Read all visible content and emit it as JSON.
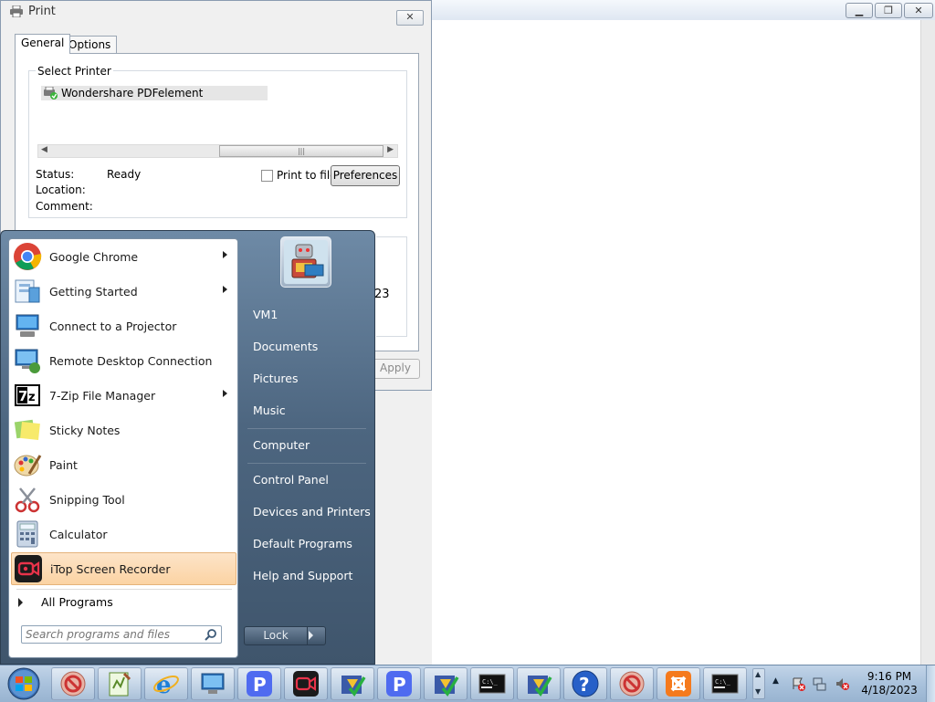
{
  "print_dialog": {
    "title": "Print",
    "close_label": "✕",
    "tabs": [
      "General",
      "Options"
    ],
    "select_printer_label": "Select Printer",
    "printer_name": "Wondershare PDFelement",
    "status_label": "Status:",
    "status_value": "Ready",
    "location_label": "Location:",
    "comment_label": "Comment:",
    "print_to_file_label": "Print to file",
    "preferences_label": "Preferences",
    "apply_label": "Apply",
    "page_numbers": "23"
  },
  "start_menu": {
    "programs": [
      {
        "label": "Google Chrome",
        "icon": "chrome-icon",
        "has_submenu": true
      },
      {
        "label": "Getting Started",
        "icon": "getting-started-icon",
        "has_submenu": true
      },
      {
        "label": "Connect to a Projector",
        "icon": "projector-icon",
        "has_submenu": false
      },
      {
        "label": "Remote Desktop Connection",
        "icon": "remote-desktop-icon",
        "has_submenu": false
      },
      {
        "label": "7-Zip File Manager",
        "icon": "7zip-icon",
        "has_submenu": true
      },
      {
        "label": "Sticky Notes",
        "icon": "sticky-notes-icon",
        "has_submenu": false
      },
      {
        "label": "Paint",
        "icon": "paint-icon",
        "has_submenu": false
      },
      {
        "label": "Snipping Tool",
        "icon": "snipping-tool-icon",
        "has_submenu": false
      },
      {
        "label": "Calculator",
        "icon": "calculator-icon",
        "has_submenu": false
      },
      {
        "label": "iTop Screen Recorder",
        "icon": "itop-recorder-icon",
        "has_submenu": false,
        "highlighted": true
      }
    ],
    "all_programs_label": "All Programs",
    "search_placeholder": "Search programs and files",
    "right_items": [
      "VM1",
      "Documents",
      "Pictures",
      "Music",
      "Computer",
      "Control Panel",
      "Devices and Printers",
      "Default Programs",
      "Help and Support"
    ],
    "lock_label": "Lock"
  },
  "taskbar": {
    "buttons": [
      "no-entry-app-icon",
      "notepad-plus-icon",
      "internet-explorer-icon",
      "remote-desktop-icon",
      "pdfelement-icon",
      "itop-recorder-icon",
      "checklist-app-icon",
      "pdfelement-icon",
      "checklist-app-icon",
      "command-prompt-icon",
      "checklist-app-icon",
      "help-icon",
      "no-entry-app-icon",
      "xampp-icon",
      "command-prompt-icon"
    ],
    "time": "9:16 PM",
    "date": "4/18/2023"
  },
  "colors": {
    "highlight": "#fbd3a3",
    "start_panel": "#4d6680",
    "taskbar": "#a9c2dc"
  }
}
